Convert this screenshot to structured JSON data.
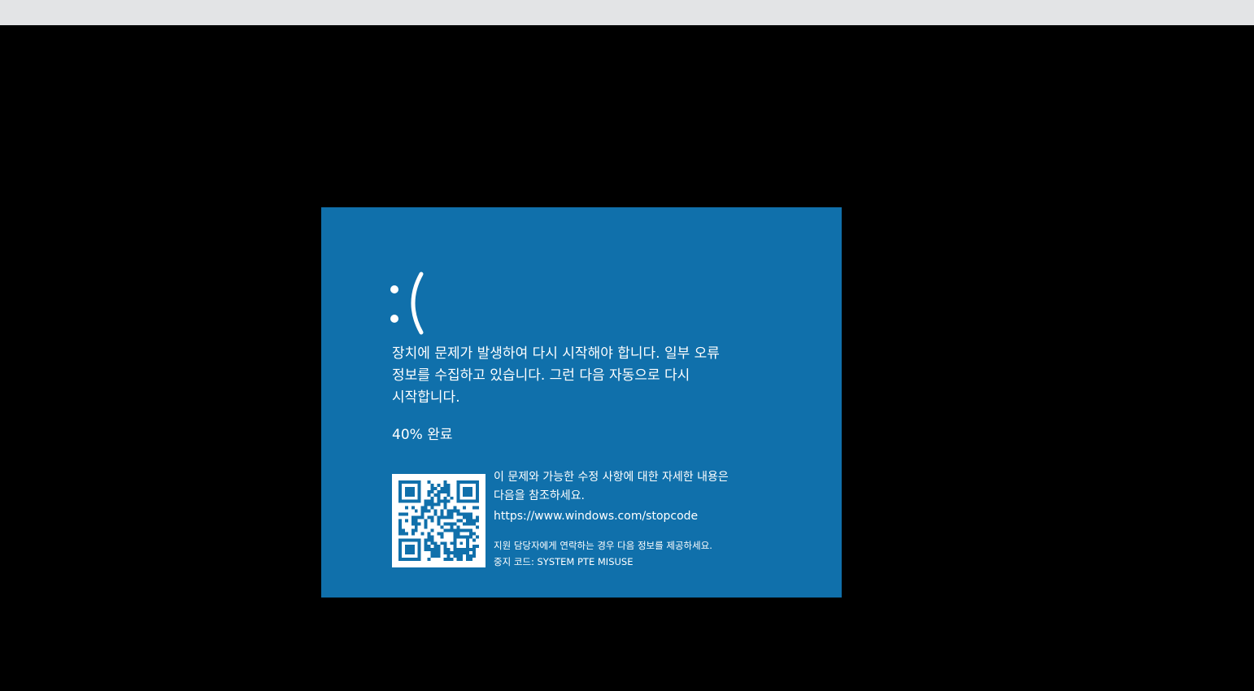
{
  "screen": {
    "background_color": "#000000",
    "topbar_color": "#e3e4e6",
    "panel_color": "#1070ab",
    "text_color": "#ffffff"
  },
  "error": {
    "face": ":(",
    "message": "장치에 문제가 발생하여 다시 시작해야 합니다. 일부 오류\n정보를 수집하고 있습니다. 그런 다음 자동으로 다시\n시작합니다.",
    "progress_text": "40% 완료",
    "progress_percent": 40
  },
  "qr": {
    "icon": "qr-code-icon"
  },
  "info": {
    "description": "이 문제와 가능한 수정 사항에 대한 자세한 내용은\n다음을 참조하세요.",
    "url": "https://www.windows.com/stopcode",
    "support_text": "지원 담당자에게 연락하는 경우 다음 정보를 제공하세요.",
    "stop_code_line": "중지 코드: SYSTEM PTE MISUSE"
  }
}
